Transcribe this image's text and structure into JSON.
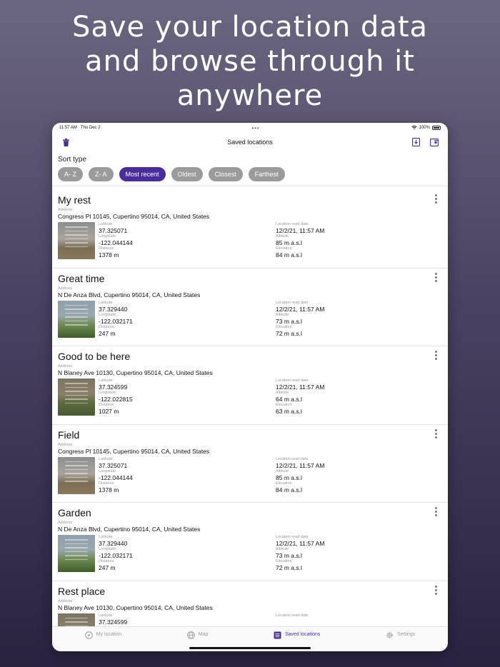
{
  "headline": {
    "line1": "Save your location data",
    "line2": "and browse through it",
    "line3": "anywhere"
  },
  "status": {
    "time": "11:57 AM",
    "date": "Thu Dec 2",
    "battery": "100%"
  },
  "nav": {
    "title": "Saved locations"
  },
  "sort": {
    "label": "Sort type",
    "chips": [
      "A- Z",
      "Z- A",
      "Most recent",
      "Oldest",
      "Closest",
      "Farthest"
    ],
    "active": "Most recent"
  },
  "labels": {
    "address": "Address",
    "latitude": "Latitude",
    "longitude": "Longitude",
    "distance": "Distance",
    "read_date": "Location read date",
    "altitude": "Altitude",
    "elevation": "Elevation"
  },
  "locations": [
    {
      "title": "My rest",
      "address": "Congress Pl 10145, Cupertino 95014, CA, United States",
      "latitude": "37.325071",
      "longitude": "-122.044144",
      "distance": "1378 m",
      "read_date": "12/2/21, 11:57 AM",
      "altitude": "85 m a.s.l",
      "elevation": "84 m a.s.l"
    },
    {
      "title": "Great time",
      "address": "N De Anza Blvd, Cupertino 95014, CA, United States",
      "latitude": "37.329440",
      "longitude": "-122.032171",
      "distance": "247 m",
      "read_date": "12/2/21, 11:57 AM",
      "altitude": "73 m a.s.l",
      "elevation": "72 m a.s.l"
    },
    {
      "title": "Good to be here",
      "address": "N Blaney Ave 10130, Cupertino 95014, CA, United States",
      "latitude": "37.324599",
      "longitude": "-122.022815",
      "distance": "1027 m",
      "read_date": "12/2/21, 11:57 AM",
      "altitude": "64 m a.s.l",
      "elevation": "63 m a.s.l"
    },
    {
      "title": "Field",
      "address": "Congress Pl 10145, Cupertino 95014, CA, United States",
      "latitude": "37.325071",
      "longitude": "-122.044144",
      "distance": "1378 m",
      "read_date": "12/2/21, 11:57 AM",
      "altitude": "85 m a.s.l",
      "elevation": "84 m a.s.l"
    },
    {
      "title": "Garden",
      "address": "N De Anza Blvd, Cupertino 95014, CA, United States",
      "latitude": "37.329440",
      "longitude": "-122.032171",
      "distance": "247 m",
      "read_date": "12/2/21, 11:57 AM",
      "altitude": "73 m a.s.l",
      "elevation": "72 m a.s.l"
    },
    {
      "title": "Rest place",
      "address": "N Blaney Ave 10130, Cupertino 95014, CA, United States",
      "latitude": "37.324599",
      "longitude": "",
      "distance": "",
      "read_date": "",
      "altitude": "",
      "elevation": ""
    }
  ],
  "tabs": [
    {
      "label": "My location",
      "icon": "compass-icon"
    },
    {
      "label": "Map",
      "icon": "globe-icon"
    },
    {
      "label": "Saved locations",
      "icon": "list-icon"
    },
    {
      "label": "Settings",
      "icon": "gear-icon"
    }
  ],
  "colors": {
    "accent": "#4a2c9e",
    "chip": "#9b9b9b",
    "bg_top": "#6b6680",
    "bg_bottom": "#2a2340"
  }
}
